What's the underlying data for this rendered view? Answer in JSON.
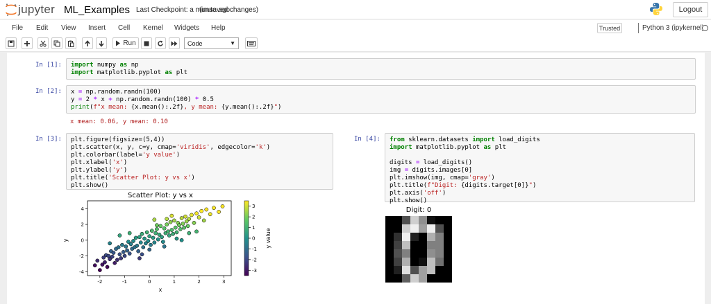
{
  "header": {
    "logo_text": "jupyter",
    "notebook_name": "ML_Examples",
    "checkpoint": "Last Checkpoint: a minute ago",
    "unsaved": "(unsaved changes)",
    "logout_label": "Logout"
  },
  "menubar": {
    "items": [
      "File",
      "Edit",
      "View",
      "Insert",
      "Cell",
      "Kernel",
      "Widgets",
      "Help"
    ],
    "trusted": "Trusted",
    "kernel": "Python 3 (ipykernel)"
  },
  "toolbar": {
    "run_label": "Run",
    "cell_type": "Code",
    "icons": [
      "save-icon",
      "plus-icon",
      "cut-icon",
      "copy-icon",
      "paste-icon",
      "arrow-up-icon",
      "arrow-down-icon",
      "run-icon",
      "stop-icon",
      "restart-icon",
      "fast-forward-icon",
      "keyboard-icon"
    ]
  },
  "cells": [
    {
      "prompt": "In [1]:",
      "lines": [
        [
          [
            "kw",
            "import"
          ],
          [
            "t",
            " numpy "
          ],
          [
            "kw",
            "as"
          ],
          [
            "t",
            " np"
          ]
        ],
        [
          [
            "kw",
            "import"
          ],
          [
            "t",
            " matplotlib.pyplot "
          ],
          [
            "kw",
            "as"
          ],
          [
            "t",
            " plt"
          ]
        ]
      ]
    },
    {
      "prompt": "In [2]:",
      "lines": [
        [
          [
            "t",
            "x "
          ],
          [
            "op",
            "="
          ],
          [
            "t",
            " np.random.randn(100)"
          ]
        ],
        [
          [
            "t",
            "y "
          ],
          [
            "op",
            "="
          ],
          [
            "t",
            " 2 "
          ],
          [
            "op",
            "*"
          ],
          [
            "t",
            " x "
          ],
          [
            "op",
            "+"
          ],
          [
            "t",
            " np.random.randn(100) "
          ],
          [
            "op",
            "*"
          ],
          [
            "t",
            " 0.5"
          ]
        ],
        [
          [
            "nm",
            "print"
          ],
          [
            "t",
            "("
          ],
          [
            "st",
            "f\"x mean: "
          ],
          [
            "t",
            "{x.mean():.2f}"
          ],
          [
            "st",
            ", y mean: "
          ],
          [
            "t",
            "{y.mean():.2f}"
          ],
          [
            "st",
            "\""
          ],
          [
            "t",
            ")"
          ]
        ]
      ],
      "output": "x mean: 0.06, y mean: 0.10"
    },
    {
      "prompt": "In [3]:",
      "lines": [
        [
          [
            "t",
            "plt.figure(figsize=(5,4))"
          ]
        ],
        [
          [
            "t",
            "plt.scatter(x, y, c=y, cmap="
          ],
          [
            "st",
            "'viridis'"
          ],
          [
            "t",
            ", edgecolor="
          ],
          [
            "st",
            "'k'"
          ],
          [
            "t",
            ")"
          ]
        ],
        [
          [
            "t",
            "plt.colorbar(label="
          ],
          [
            "st",
            "'y value'"
          ],
          [
            "t",
            ")"
          ]
        ],
        [
          [
            "t",
            "plt.xlabel("
          ],
          [
            "st",
            "'x'"
          ],
          [
            "t",
            ")"
          ]
        ],
        [
          [
            "t",
            "plt.ylabel("
          ],
          [
            "st",
            "'y'"
          ],
          [
            "t",
            ")"
          ]
        ],
        [
          [
            "t",
            "plt.title("
          ],
          [
            "st",
            "'Scatter Plot: y vs x'"
          ],
          [
            "t",
            ")"
          ]
        ],
        [
          [
            "t",
            "plt.show()"
          ]
        ]
      ]
    },
    {
      "prompt": "In [4]:",
      "lines": [
        [
          [
            "kw",
            "from"
          ],
          [
            "t",
            " sklearn.datasets "
          ],
          [
            "kw",
            "import"
          ],
          [
            "t",
            " load_digits"
          ]
        ],
        [
          [
            "kw",
            "import"
          ],
          [
            "t",
            " matplotlib.pyplot "
          ],
          [
            "kw",
            "as"
          ],
          [
            "t",
            " plt"
          ]
        ],
        [
          [
            "t",
            ""
          ]
        ],
        [
          [
            "t",
            "digits "
          ],
          [
            "op",
            "="
          ],
          [
            "t",
            " load_digits()"
          ]
        ],
        [
          [
            "t",
            "img "
          ],
          [
            "op",
            "="
          ],
          [
            "t",
            " digits.images[0]"
          ]
        ],
        [
          [
            "t",
            "plt.imshow(img, cmap="
          ],
          [
            "st",
            "'gray'"
          ],
          [
            "t",
            ")"
          ]
        ],
        [
          [
            "t",
            "plt.title("
          ],
          [
            "st",
            "f\"Digit: "
          ],
          [
            "t",
            "{digits.target[0]}"
          ],
          [
            "st",
            "\""
          ],
          [
            "t",
            ")"
          ]
        ],
        [
          [
            "t",
            "plt.axis("
          ],
          [
            "st",
            "'off'"
          ],
          [
            "t",
            ")"
          ]
        ],
        [
          [
            "t",
            "plt.show()"
          ]
        ]
      ]
    }
  ],
  "chart_data": [
    {
      "type": "scatter",
      "title": "Scatter Plot: y vs x",
      "xlabel": "x",
      "ylabel": "y",
      "xlim": [
        -2.5,
        3.3
      ],
      "ylim": [
        -4.5,
        5.0
      ],
      "xticks": [
        "-2",
        "-1",
        "0",
        "1",
        "2",
        "3"
      ],
      "yticks": [
        "-4",
        "-2",
        "0",
        "2",
        "4"
      ],
      "colorbar": {
        "label": "y value",
        "ticks": [
          "-3",
          "-2",
          "-1",
          "0",
          "1",
          "2",
          "3"
        ],
        "range": [
          -3.5,
          3.5
        ],
        "cmap": "viridis"
      },
      "x": [
        -2.2,
        -2.1,
        -2.0,
        -1.9,
        -1.85,
        -1.8,
        -1.75,
        -1.7,
        -1.65,
        -1.6,
        -1.55,
        -1.5,
        -1.45,
        -1.4,
        -1.35,
        -1.3,
        -1.25,
        -1.2,
        -1.15,
        -1.1,
        -1.05,
        -1.0,
        -0.95,
        -0.9,
        -0.85,
        -0.8,
        -0.75,
        -0.7,
        -0.65,
        -0.6,
        -0.55,
        -0.5,
        -0.45,
        -0.4,
        -0.35,
        -0.3,
        -0.25,
        -0.2,
        -0.15,
        -0.1,
        -0.05,
        0.0,
        0.05,
        0.1,
        0.15,
        0.2,
        0.25,
        0.3,
        0.35,
        0.4,
        0.45,
        0.5,
        0.55,
        0.6,
        0.65,
        0.7,
        0.75,
        0.8,
        0.85,
        0.9,
        0.95,
        1.0,
        1.05,
        1.1,
        1.15,
        1.2,
        1.25,
        1.3,
        1.35,
        1.4,
        1.45,
        1.5,
        1.55,
        1.6,
        1.7,
        1.8,
        1.9,
        2.0,
        2.1,
        2.2,
        2.3,
        2.45,
        2.6,
        2.8,
        2.95,
        -0.3,
        0.3,
        0.6,
        1.1,
        -0.8,
        -1.2,
        0.9,
        1.6,
        -0.4,
        0.2,
        1.3,
        -1.6,
        0.0,
        0.7,
        1.9
      ],
      "y": [
        -3.2,
        -2.6,
        -3.8,
        -3.1,
        -2.2,
        -2.8,
        -1.9,
        -3.4,
        -2.0,
        -2.4,
        -1.4,
        -2.1,
        -1.6,
        -2.9,
        -1.1,
        -2.5,
        -0.9,
        -1.8,
        -2.3,
        -0.6,
        -1.5,
        -2.0,
        -0.8,
        -1.3,
        -0.2,
        -1.7,
        -0.5,
        -1.1,
        -0.1,
        -0.9,
        0.3,
        -0.7,
        -1.4,
        0.4,
        -0.3,
        0.8,
        -0.9,
        0.2,
        -0.4,
        1.0,
        -0.1,
        0.5,
        -0.6,
        1.2,
        0.3,
        -0.3,
        0.9,
        1.4,
        0.1,
        0.7,
        1.8,
        0.4,
        -0.2,
        1.5,
        0.9,
        2.0,
        1.1,
        0.6,
        2.3,
        1.3,
        0.8,
        2.5,
        1.6,
        1.0,
        2.2,
        1.9,
        1.4,
        2.8,
        2.1,
        1.6,
        3.0,
        2.4,
        1.8,
        2.7,
        3.2,
        2.2,
        3.4,
        2.9,
        3.7,
        2.5,
        3.9,
        3.3,
        4.1,
        3.6,
        4.3,
        -1.8,
        1.9,
        -0.8,
        0.2,
        0.9,
        0.6,
        3.1,
        0.9,
        -2.3,
        2.6,
        0.0,
        -0.4,
        -1.2,
        2.7,
        1.1
      ]
    },
    {
      "type": "heatmap",
      "title": "Digit: 0",
      "cmap": "gray",
      "pixels": [
        [
          0,
          0,
          5,
          13,
          9,
          1,
          0,
          0
        ],
        [
          0,
          0,
          13,
          15,
          10,
          15,
          5,
          0
        ],
        [
          0,
          3,
          15,
          2,
          0,
          11,
          8,
          0
        ],
        [
          0,
          4,
          12,
          0,
          0,
          8,
          8,
          0
        ],
        [
          0,
          5,
          8,
          0,
          0,
          9,
          8,
          0
        ],
        [
          0,
          4,
          11,
          0,
          1,
          12,
          7,
          0
        ],
        [
          0,
          2,
          14,
          5,
          10,
          12,
          0,
          0
        ],
        [
          0,
          0,
          6,
          13,
          10,
          0,
          0,
          0
        ]
      ]
    }
  ]
}
